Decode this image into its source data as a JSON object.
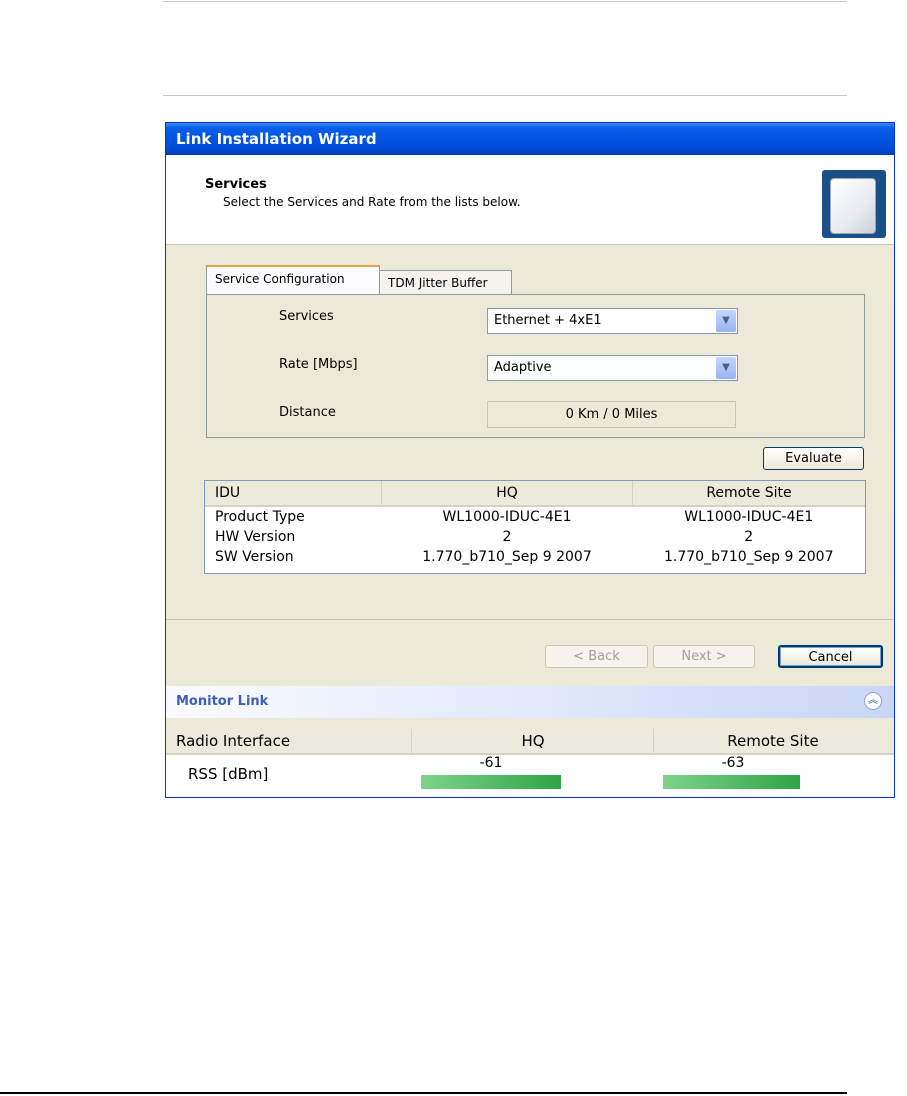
{
  "window": {
    "title": "Link Installation Wizard"
  },
  "header": {
    "title": "Services",
    "subtitle": "Select the Services and Rate from the lists below."
  },
  "tabs": [
    {
      "label": "Service Configuration",
      "active": true
    },
    {
      "label": "TDM Jitter Buffer",
      "active": false
    }
  ],
  "config": {
    "services_label": "Services",
    "services_value": "Ethernet + 4xE1",
    "rate_label": "Rate [Mbps]",
    "rate_value": "Adaptive",
    "distance_label": "Distance",
    "distance_value": "0 Km / 0 Miles"
  },
  "evaluate_label": "Evaluate",
  "idu_table": {
    "headers": [
      "IDU",
      "HQ",
      "Remote Site"
    ],
    "rows": [
      [
        "Product Type",
        "WL1000-IDUC-4E1",
        "WL1000-IDUC-4E1"
      ],
      [
        "HW Version",
        "2",
        "2"
      ],
      [
        "SW Version",
        "1.770_b710_Sep  9 2007",
        "1.770_b710_Sep  9 2007"
      ]
    ]
  },
  "nav": {
    "back_label": "< Back",
    "next_label": "Next >",
    "cancel_label": "Cancel"
  },
  "monitor": {
    "title": "Monitor Link",
    "headers": [
      "Radio Interface",
      "HQ",
      "Remote Site"
    ],
    "rss_label": "RSS [dBm]",
    "hq_value": "-61",
    "remote_value": "-63"
  },
  "colors": {
    "accent": "#0054e3",
    "rss_bar": "#2fa447"
  }
}
